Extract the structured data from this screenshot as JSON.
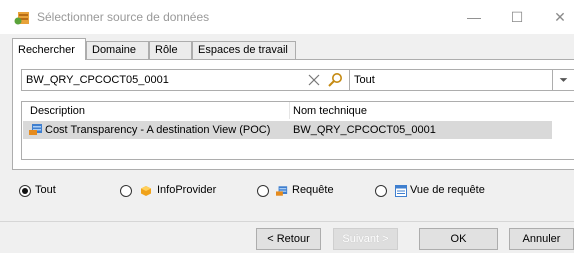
{
  "window": {
    "title": "Sélectionner source de données",
    "icon": "datasource-app-icon",
    "controls": {
      "minimize": "—",
      "maximize": "☐",
      "close": "✕"
    }
  },
  "tabs": [
    {
      "label": "Rechercher",
      "active": true
    },
    {
      "label": "Domaine",
      "active": false
    },
    {
      "label": "Rôle",
      "active": false
    },
    {
      "label": "Espaces de travail",
      "active": false
    }
  ],
  "search": {
    "value": "BW_QRY_CPCOCT05_0001",
    "scope": "Tout"
  },
  "results": {
    "columns": [
      "Description",
      "Nom technique"
    ],
    "rows": [
      {
        "description": "Cost Transparency  - A destination View (POC)",
        "technical_name": "BW_QRY_CPCOCT05_0001",
        "selected": true
      }
    ]
  },
  "filter": {
    "options": [
      {
        "label": "Tout",
        "checked": true,
        "icon": ""
      },
      {
        "label": "InfoProvider",
        "checked": false,
        "icon": "infoprovider-icon"
      },
      {
        "label": "Requête",
        "checked": false,
        "icon": "query-icon"
      },
      {
        "label": "Vue de requête",
        "checked": false,
        "icon": "query-view-icon"
      }
    ]
  },
  "buttons": {
    "back": "< Retour",
    "next": "Suivant >",
    "ok": "OK",
    "cancel": "Annuler"
  },
  "colors": {
    "selection": "#d9d9d9",
    "border": "#adadad",
    "dialog_bg": "#f0f0f0"
  }
}
